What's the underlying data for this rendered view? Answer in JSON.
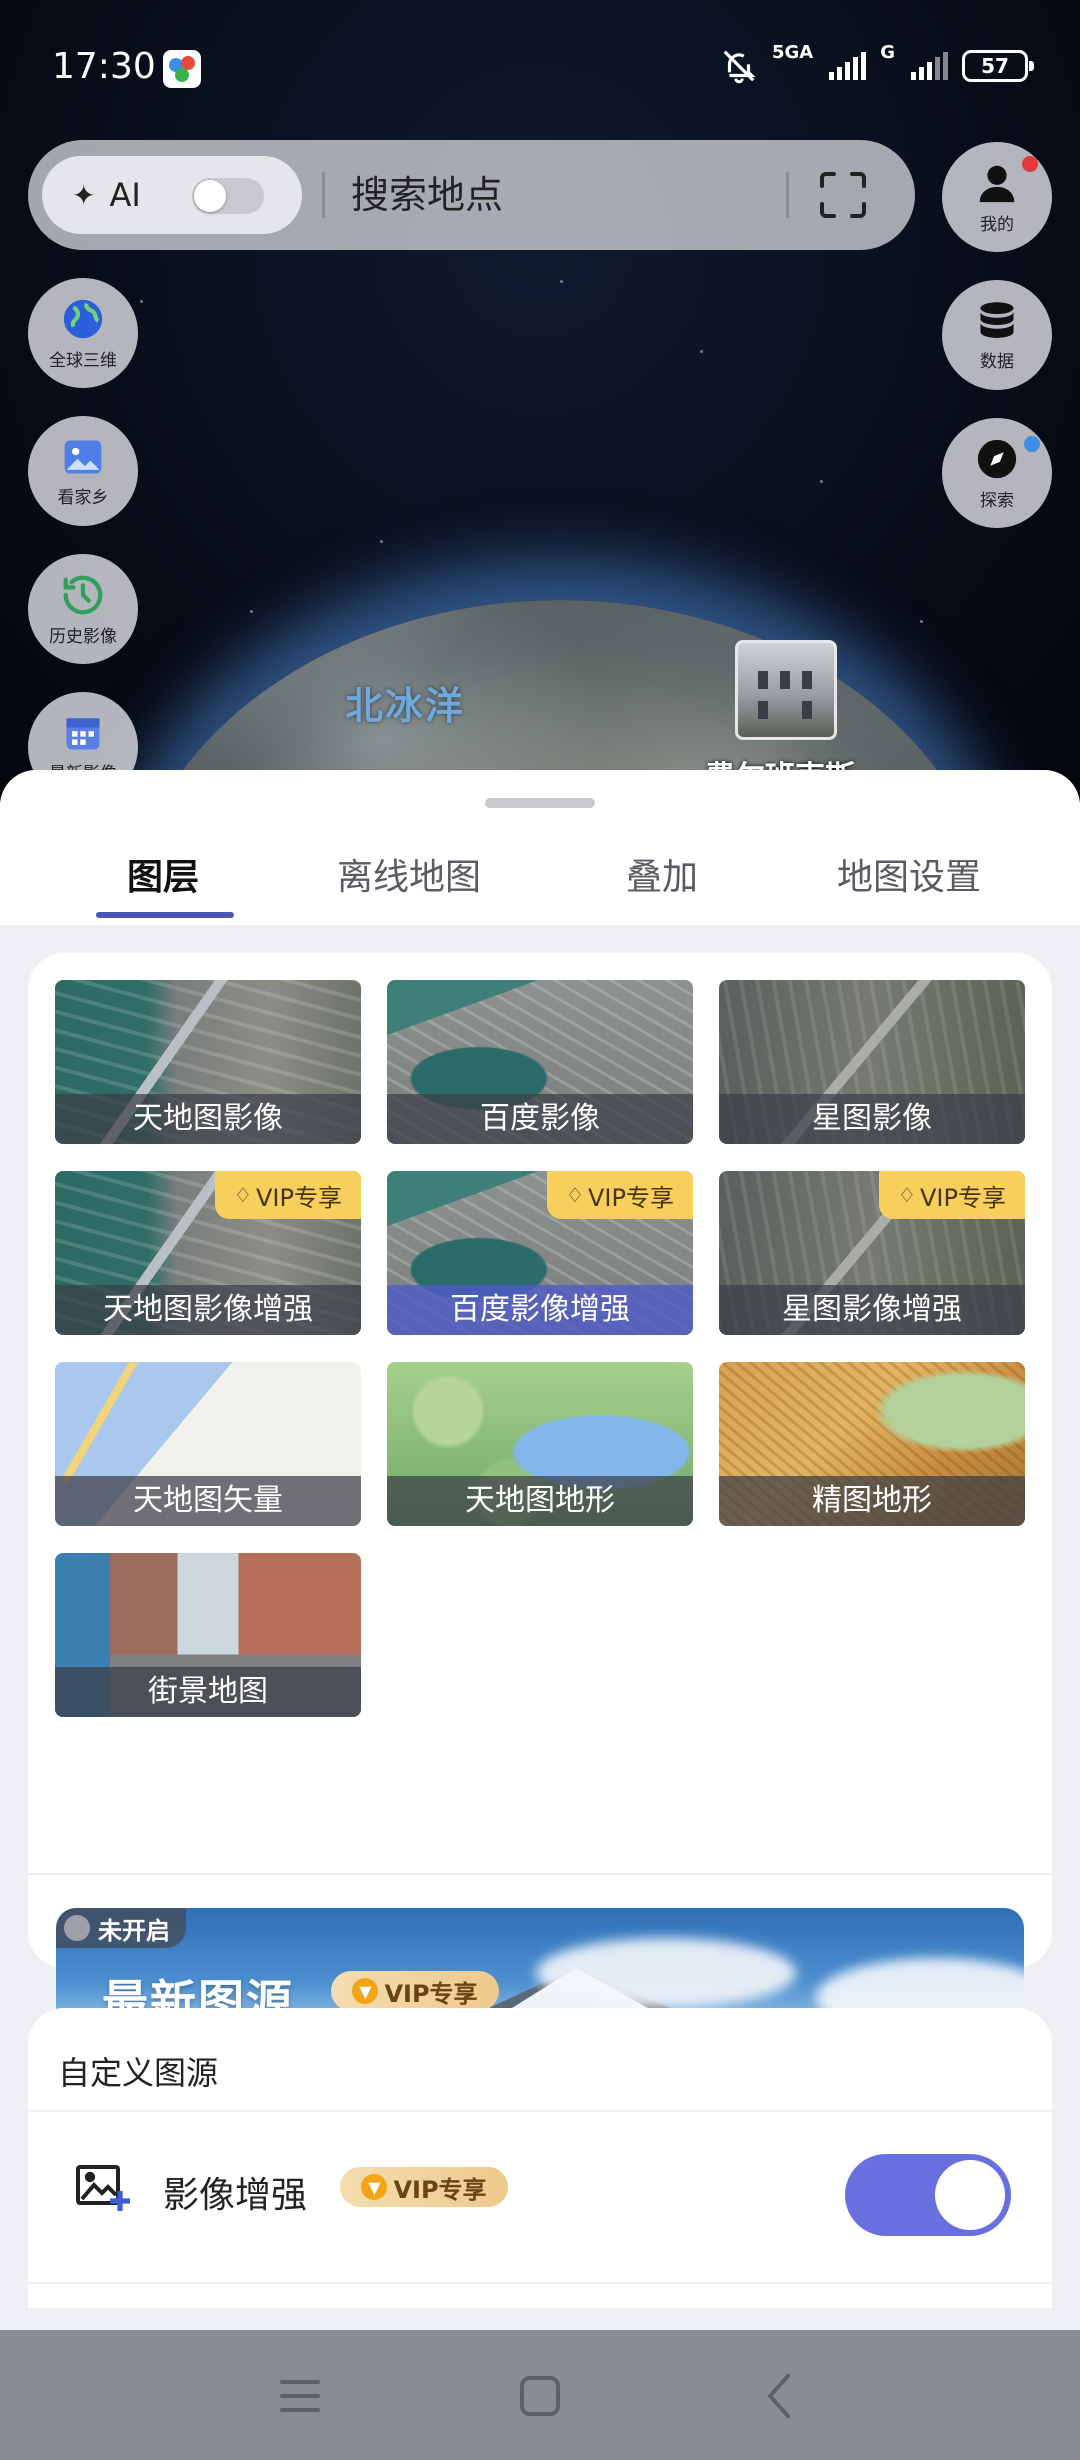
{
  "status_bar": {
    "time": "17:30",
    "network_1": "5GA",
    "network_2": "G",
    "battery": "57"
  },
  "search_bar": {
    "ai_label": "AI",
    "placeholder": "搜索地点"
  },
  "left_buttons": [
    {
      "label": "全球三维",
      "icon": "globe-icon"
    },
    {
      "label": "看家乡",
      "icon": "image-icon"
    },
    {
      "label": "历史影像",
      "icon": "history-icon"
    },
    {
      "label": "最新影像",
      "icon": "calendar-icon"
    }
  ],
  "right_buttons": [
    {
      "label": "我的",
      "icon": "user-icon"
    },
    {
      "label": "数据",
      "icon": "database-icon"
    },
    {
      "label": "探索",
      "icon": "compass-icon"
    }
  ],
  "map": {
    "ocean_label": "北冰洋",
    "place_label": "费尔班克斯"
  },
  "tabs": [
    {
      "label": "图层",
      "active": true
    },
    {
      "label": "离线地图",
      "active": false
    },
    {
      "label": "叠加",
      "active": false
    },
    {
      "label": "地图设置",
      "active": false
    }
  ],
  "layers": [
    {
      "label": "天地图影像",
      "vip": false
    },
    {
      "label": "百度影像",
      "vip": false
    },
    {
      "label": "星图影像",
      "vip": false
    },
    {
      "label": "天地图影像增强",
      "vip": true
    },
    {
      "label": "百度影像增强",
      "vip": true
    },
    {
      "label": "星图影像增强",
      "vip": true
    },
    {
      "label": "天地图矢量",
      "vip": false
    },
    {
      "label": "天地图地形",
      "vip": false
    },
    {
      "label": "精图地形",
      "vip": false
    },
    {
      "label": "街景地图",
      "vip": false
    }
  ],
  "vip_tag_label": "VIP专享",
  "banner": {
    "status": "未开启",
    "title": "最新图源",
    "vip_label": "VIP专享"
  },
  "custom_source": {
    "title": "自定义图源",
    "enhance_label": "影像增强",
    "vip_label": "VIP专享",
    "enhance_enabled": true
  },
  "colors": {
    "accent": "#6a6fe0",
    "tab_underline": "#4a55b8",
    "vip_gold": "#f6cf5c",
    "notification_red": "#e5383b"
  }
}
